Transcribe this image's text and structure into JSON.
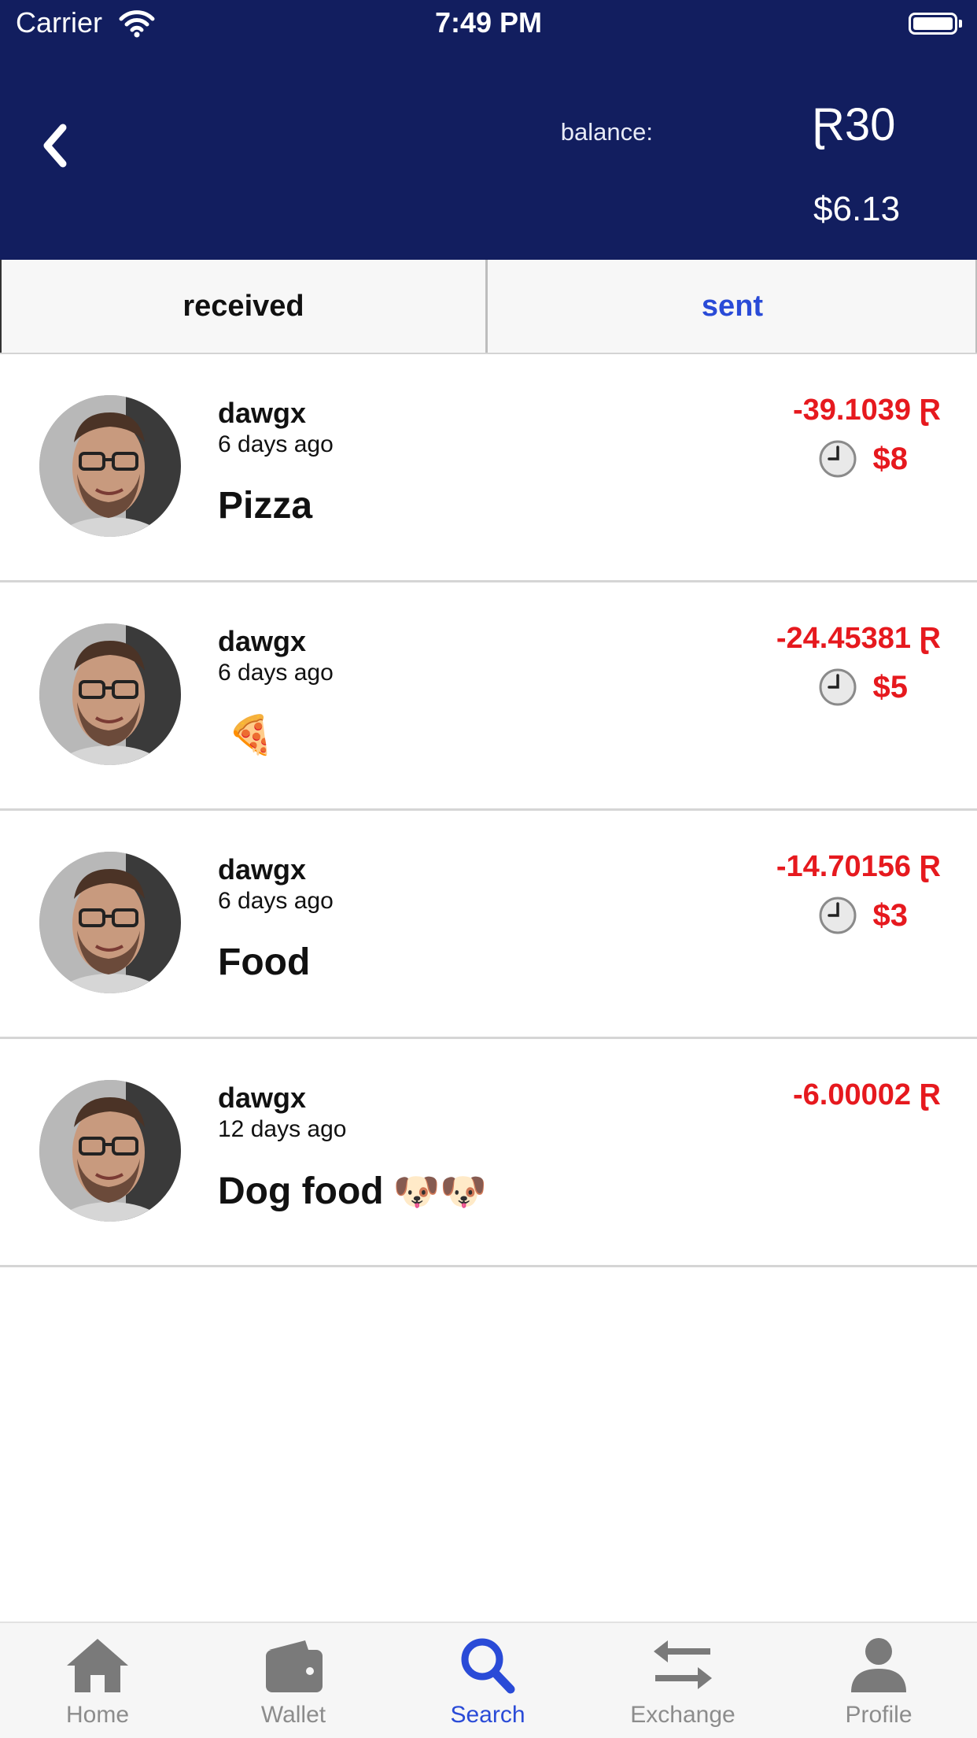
{
  "status_bar": {
    "carrier": "Carrier",
    "time": "7:49 PM"
  },
  "header": {
    "balance_label": "balance:",
    "balance_value": "Ɽ30",
    "balance_usd": "$6.13"
  },
  "tabs": [
    {
      "label": "received",
      "active": false
    },
    {
      "label": "sent",
      "active": true
    }
  ],
  "transactions": [
    {
      "name": "dawgx",
      "time": "6 days ago",
      "note": "Pizza",
      "note_emoji": "",
      "amount": "-39.1039 Ɽ",
      "usd": "$8",
      "pending": true
    },
    {
      "name": "dawgx",
      "time": "6 days ago",
      "note": "",
      "note_emoji": "🍕",
      "amount": "-24.45381 Ɽ",
      "usd": "$5",
      "pending": true
    },
    {
      "name": "dawgx",
      "time": "6 days ago",
      "note": "Food",
      "note_emoji": "",
      "amount": "-14.70156 Ɽ",
      "usd": "$3",
      "pending": true
    },
    {
      "name": "dawgx",
      "time": "12 days ago",
      "note": "Dog food",
      "note_emoji": "🐶🐶",
      "amount": "-6.00002 Ɽ",
      "usd": "",
      "pending": false
    }
  ],
  "tabbar": {
    "items": [
      {
        "label": "Home",
        "icon": "home-icon"
      },
      {
        "label": "Wallet",
        "icon": "wallet-icon"
      },
      {
        "label": "Search",
        "icon": "search-icon",
        "active": true
      },
      {
        "label": "Exchange",
        "icon": "exchange-icon"
      },
      {
        "label": "Profile",
        "icon": "profile-icon"
      }
    ]
  },
  "colors": {
    "header_bg": "#121e5f",
    "accent": "#2a4bd7",
    "negative": "#e6191e"
  }
}
